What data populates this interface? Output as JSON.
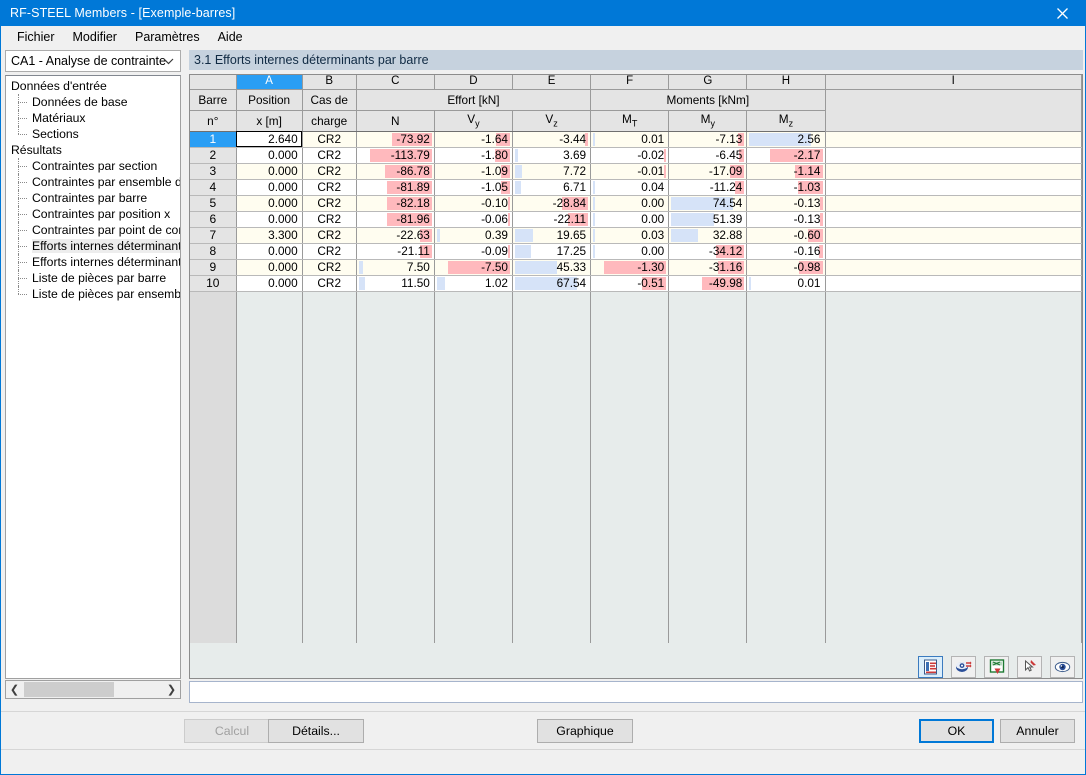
{
  "window": {
    "title": "RF-STEEL Members - [Exemple-barres]",
    "close_icon": "close-icon"
  },
  "menu": {
    "items": [
      {
        "label": "Fichier"
      },
      {
        "label": "Modifier"
      },
      {
        "label": "Paramètres"
      },
      {
        "label": "Aide"
      }
    ]
  },
  "sidebar": {
    "combo_value": "CA1 - Analyse de contrainte",
    "tree": [
      {
        "label": "Données d'entrée",
        "level": 0,
        "selected": false
      },
      {
        "label": "Données de base",
        "level": 1,
        "selected": false
      },
      {
        "label": "Matériaux",
        "level": 1,
        "selected": false
      },
      {
        "label": "Sections",
        "level": 1,
        "selected": false,
        "last": true
      },
      {
        "label": "Résultats",
        "level": 0,
        "selected": false
      },
      {
        "label": "Contraintes par section",
        "level": 1,
        "selected": false
      },
      {
        "label": "Contraintes par ensemble de barres",
        "level": 1,
        "selected": false
      },
      {
        "label": "Contraintes par barre",
        "level": 1,
        "selected": false
      },
      {
        "label": "Contraintes par position x",
        "level": 1,
        "selected": false
      },
      {
        "label": "Contraintes par point de contrainte",
        "level": 1,
        "selected": false
      },
      {
        "label": "Efforts internes déterminants par barre",
        "level": 1,
        "selected": true
      },
      {
        "label": "Efforts internes déterminants par ensemble de barres",
        "level": 1,
        "selected": false
      },
      {
        "label": "Liste de pièces par barre",
        "level": 1,
        "selected": false
      },
      {
        "label": "Liste de pièces par ensemble de barres",
        "level": 1,
        "selected": false,
        "last": true
      }
    ],
    "buttons": [
      {
        "name": "help-button",
        "icon": "question-mark-icon"
      },
      {
        "name": "prev-panel-button",
        "icon": "arrow-left-panel-icon"
      },
      {
        "name": "next-panel-button",
        "icon": "arrow-right-panel-icon"
      }
    ]
  },
  "main": {
    "section_title": "3.1 Efforts internes déterminants par barre",
    "grid_tools": [
      {
        "name": "report-button",
        "icon": "report-icon",
        "active": true
      },
      {
        "name": "printout-button",
        "icon": "printout-icon",
        "active": false
      },
      {
        "name": "excel-export-button",
        "icon": "excel-icon",
        "active": false
      },
      {
        "name": "select-button",
        "icon": "cursor-pin-icon",
        "active": false
      },
      {
        "name": "view-button",
        "icon": "eye-icon",
        "active": false
      }
    ]
  },
  "chart_data": {
    "type": "table",
    "title": "3.1 Efforts internes déterminants par barre",
    "column_letters": [
      "",
      "A",
      "B",
      "C",
      "D",
      "E",
      "F",
      "G",
      "H",
      "I"
    ],
    "active_column_letter": "A",
    "group_headers": [
      {
        "label": "Effort [kN]",
        "span": [
          "C",
          "D",
          "E"
        ]
      },
      {
        "label": "Moments [kNm]",
        "span": [
          "F",
          "G",
          "H"
        ]
      }
    ],
    "headers_line1": [
      "Barre",
      "Position",
      "Cas de",
      "Effort [kN]",
      "",
      "",
      "Moments [kNm]",
      "",
      "",
      ""
    ],
    "headers_line2": [
      "n°",
      "x [m]",
      "charge",
      "N",
      "Vy",
      "Vz",
      "MT",
      "My",
      "Mz",
      ""
    ],
    "columns": [
      {
        "key": "barre",
        "letter": "",
        "h1": "Barre",
        "h2": "n°"
      },
      {
        "key": "position",
        "letter": "A",
        "h1": "Position",
        "h2": "x [m]"
      },
      {
        "key": "cas",
        "letter": "B",
        "h1": "Cas de",
        "h2": "charge"
      },
      {
        "key": "N",
        "letter": "C",
        "h1": "Effort [kN]",
        "h2": "N"
      },
      {
        "key": "Vy",
        "letter": "D",
        "h1": "",
        "h2": "Vy"
      },
      {
        "key": "Vz",
        "letter": "E",
        "h1": "",
        "h2": "Vz"
      },
      {
        "key": "MT",
        "letter": "F",
        "h1": "Moments [kNm]",
        "h2": "MT"
      },
      {
        "key": "My",
        "letter": "G",
        "h1": "",
        "h2": "My"
      },
      {
        "key": "Mz",
        "letter": "H",
        "h1": "",
        "h2": "Mz"
      },
      {
        "key": "empty",
        "letter": "I",
        "h1": "",
        "h2": ""
      }
    ],
    "rows": [
      {
        "barre": "1",
        "position": "2.640",
        "cas": "CR2",
        "N": "-73.92",
        "Vy": "-1.64",
        "Vz": "-3.44",
        "MT": "0.01",
        "My": "-7.13",
        "Mz": "2.56"
      },
      {
        "barre": "2",
        "position": "0.000",
        "cas": "CR2",
        "N": "-113.79",
        "Vy": "-1.80",
        "Vz": "3.69",
        "MT": "-0.02",
        "My": "-6.45",
        "Mz": "-2.17"
      },
      {
        "barre": "3",
        "position": "0.000",
        "cas": "CR2",
        "N": "-86.78",
        "Vy": "-1.09",
        "Vz": "7.72",
        "MT": "-0.01",
        "My": "-17.09",
        "Mz": "-1.14"
      },
      {
        "barre": "4",
        "position": "0.000",
        "cas": "CR2",
        "N": "-81.89",
        "Vy": "-1.05",
        "Vz": "6.71",
        "MT": "0.04",
        "My": "-11.24",
        "Mz": "-1.03"
      },
      {
        "barre": "5",
        "position": "0.000",
        "cas": "CR2",
        "N": "-82.18",
        "Vy": "-0.10",
        "Vz": "-28.84",
        "MT": "0.00",
        "My": "74.54",
        "Mz": "-0.13"
      },
      {
        "barre": "6",
        "position": "0.000",
        "cas": "CR2",
        "N": "-81.96",
        "Vy": "-0.06",
        "Vz": "-22.11",
        "MT": "0.00",
        "My": "51.39",
        "Mz": "-0.13"
      },
      {
        "barre": "7",
        "position": "3.300",
        "cas": "CR2",
        "N": "-22.63",
        "Vy": "0.39",
        "Vz": "19.65",
        "MT": "0.03",
        "My": "32.88",
        "Mz": "-0.60"
      },
      {
        "barre": "8",
        "position": "0.000",
        "cas": "CR2",
        "N": "-21.11",
        "Vy": "-0.09",
        "Vz": "17.25",
        "MT": "0.00",
        "My": "-34.12",
        "Mz": "-0.16"
      },
      {
        "barre": "9",
        "position": "0.000",
        "cas": "CR2",
        "N": "7.50",
        "Vy": "-7.50",
        "Vz": "45.33",
        "MT": "-1.30",
        "My": "-31.16",
        "Mz": "-0.98"
      },
      {
        "barre": "10",
        "position": "0.000",
        "cas": "CR2",
        "N": "11.50",
        "Vy": "1.02",
        "Vz": "67.54",
        "MT": "-0.51",
        "My": "-49.98",
        "Mz": "0.01"
      }
    ],
    "selected_row": 1,
    "selected_column": "A",
    "colors": {
      "bar_negative": "#ffb9bd",
      "bar_positive": "#d6e3f8",
      "row_odd_bg": "#fffdf0",
      "row_even_bg": "#ffffff",
      "header_bg": "#e4e4e4",
      "selection": "#2a9ef4",
      "section_header_bg": "#c6d2de",
      "accent": "#0078d7"
    }
  },
  "footer": {
    "calcul_label": "Calcul",
    "details_label": "Détails...",
    "graphique_label": "Graphique",
    "ok_label": "OK",
    "annuler_label": "Annuler"
  }
}
